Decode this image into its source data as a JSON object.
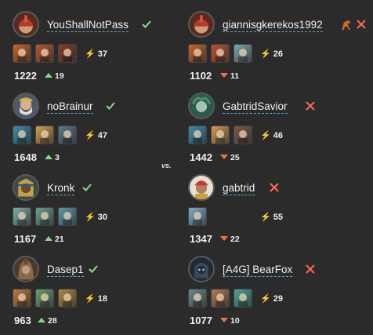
{
  "vs_label": "vs.",
  "left": [
    {
      "name": "YouShallNotPass",
      "result": "win",
      "energy": "37",
      "rating": "1222",
      "delta": "19",
      "delta_dir": "up",
      "avatar": "helmet-warrior",
      "heroes": [
        "#c8642a",
        "#b9552f",
        "#8a3a2a"
      ]
    },
    {
      "name": "noBrainur",
      "result": "win",
      "energy": "47",
      "rating": "1648",
      "delta": "3",
      "delta_dir": "up",
      "avatar": "zeus",
      "heroes": [
        "#3a8fb0",
        "#d0a050",
        "#5a7a8a"
      ]
    },
    {
      "name": "Kronk",
      "result": "win",
      "energy": "30",
      "rating": "1167",
      "delta": "21",
      "delta_dir": "up",
      "avatar": "pharaoh",
      "heroes": [
        "#7ab0a8",
        "#6aa090",
        "#5a9ab0"
      ]
    },
    {
      "name": "Dasep1",
      "result": "win",
      "energy": "18",
      "rating": "963",
      "delta": "28",
      "delta_dir": "up",
      "avatar": "hooded",
      "heroes": [
        "#c07a3a",
        "#6aa070",
        "#b08a40"
      ]
    }
  ],
  "right": [
    {
      "name": "giannisgkerekos1992",
      "result": "loss",
      "energy": "26",
      "rating": "1102",
      "delta": "11",
      "delta_dir": "down",
      "avatar": "helmet-warrior",
      "heroes": [
        "#c8642a",
        "#b9552f",
        "#7aa8b0"
      ],
      "extra_icon": "horse-icon"
    },
    {
      "name": "GabtridSavior",
      "result": "loss",
      "energy": "46",
      "rating": "1442",
      "delta": "25",
      "delta_dir": "down",
      "avatar": "gorgon",
      "heroes": [
        "#3a8fb0",
        "#d0a050",
        "#7a5a4a"
      ]
    },
    {
      "name": "gabtrid",
      "result": "loss",
      "energy": "55",
      "rating": "1347",
      "delta": "22",
      "delta_dir": "down",
      "avatar": "desert",
      "heroes": [
        "#7ab0c8"
      ]
    },
    {
      "name": "[A4G] BearFox",
      "result": "loss",
      "energy": "29",
      "rating": "1077",
      "delta": "10",
      "delta_dir": "down",
      "avatar": "dark-knight",
      "heroes": [
        "#6a8a90",
        "#b07a50",
        "#4aa8a0"
      ]
    }
  ],
  "icons": {
    "win": "checkmark-icon",
    "loss": "cross-icon",
    "energy": "lightning-icon",
    "up": "arrow-up-icon",
    "down": "arrow-down-icon"
  },
  "colors": {
    "background": "#2b2b2b",
    "win": "#8fdc8f",
    "loss": "#ff6a4a",
    "energy": "#ffcc33",
    "underline": "#5aa9d6"
  }
}
